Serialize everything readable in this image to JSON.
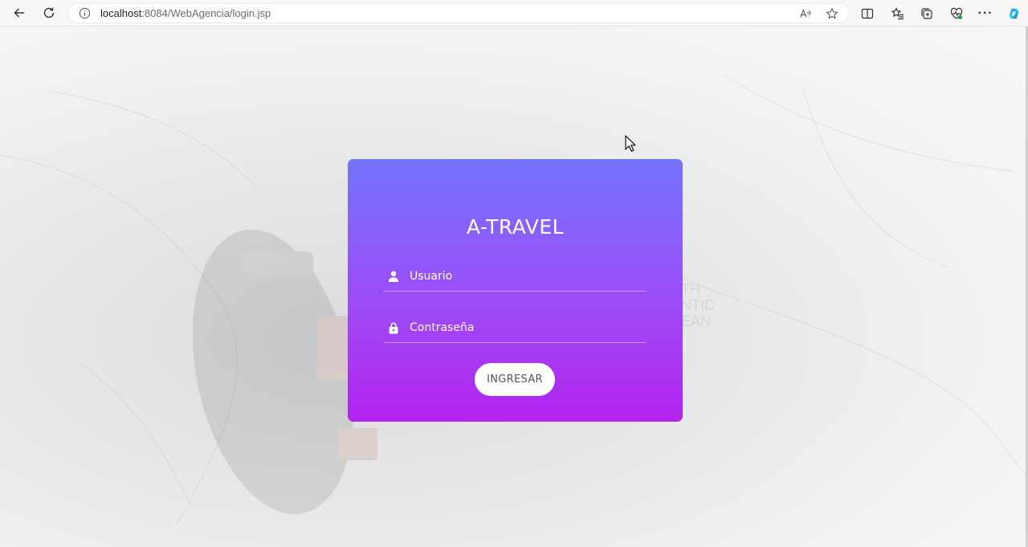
{
  "browser": {
    "url_host": "localhost",
    "url_path": ":8084/WebAgencia/login.jsp",
    "icons": [
      "back-icon",
      "reload-icon",
      "info-icon",
      "read-aloud-icon",
      "favorite-star-icon",
      "split-screen-icon",
      "favorites-icon",
      "collections-icon",
      "browser-essentials-icon",
      "more-icon",
      "copilot-icon"
    ],
    "more_label": "···"
  },
  "login": {
    "title": "A-TRAVEL",
    "username_placeholder": "Usuario",
    "password_placeholder": "Contraseña",
    "submit_label": "INGRESAR",
    "icons": [
      "user-icon",
      "lock-icon"
    ]
  },
  "colors": {
    "card_gradient_top": "#7474fd",
    "card_gradient_bottom": "#b323ee",
    "button_bg": "#ffffff",
    "button_text": "#555555"
  }
}
